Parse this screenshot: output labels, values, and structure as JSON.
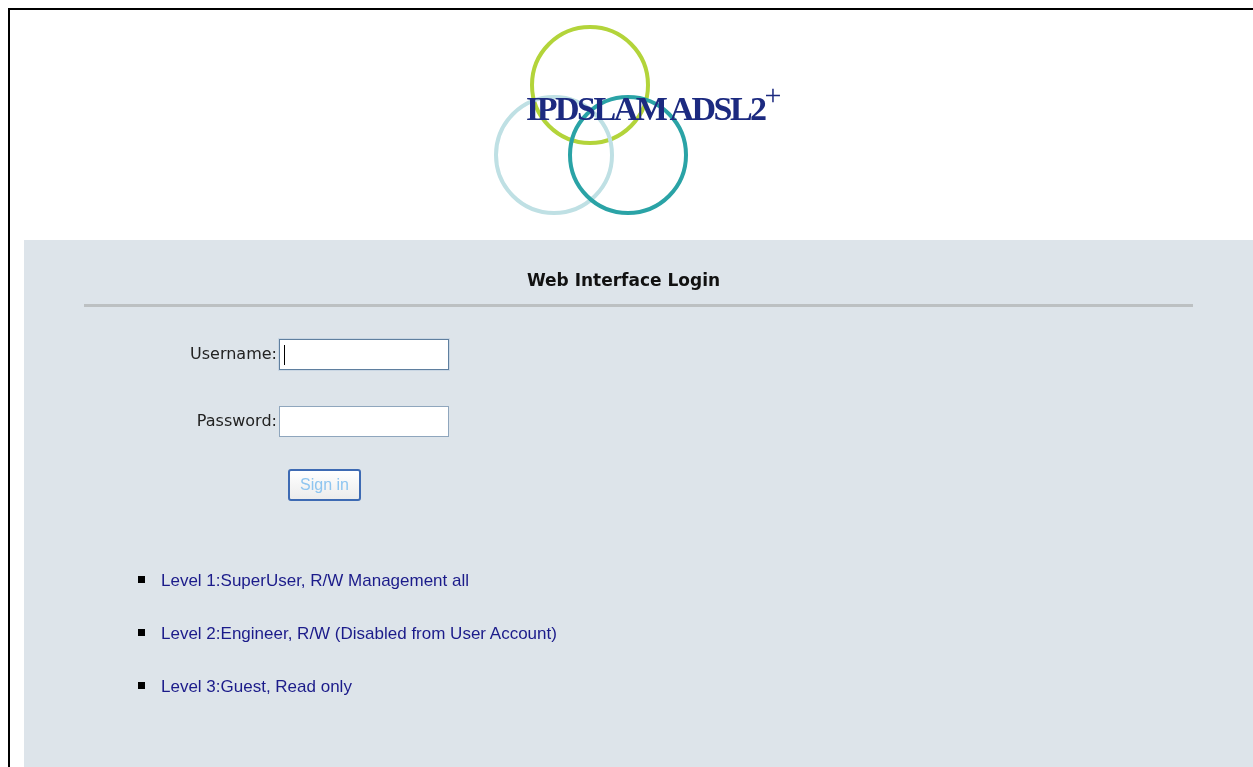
{
  "logo": {
    "text": "IPDSLAM ADSL2$^{+}$"
  },
  "login": {
    "title": "Web Interface Login",
    "fields": [
      {
        "label": "Username:",
        "focused": true
      },
      {
        "label": "Password:",
        "focused": false
      }
    ],
    "button": "Sign in"
  },
  "levels": [
    "Level 1:SuperUser, R/W Management all",
    "Level 2:Engineer, R/W (Disabled from User Account)",
    "Level 3:Guest, Read only"
  ]
}
